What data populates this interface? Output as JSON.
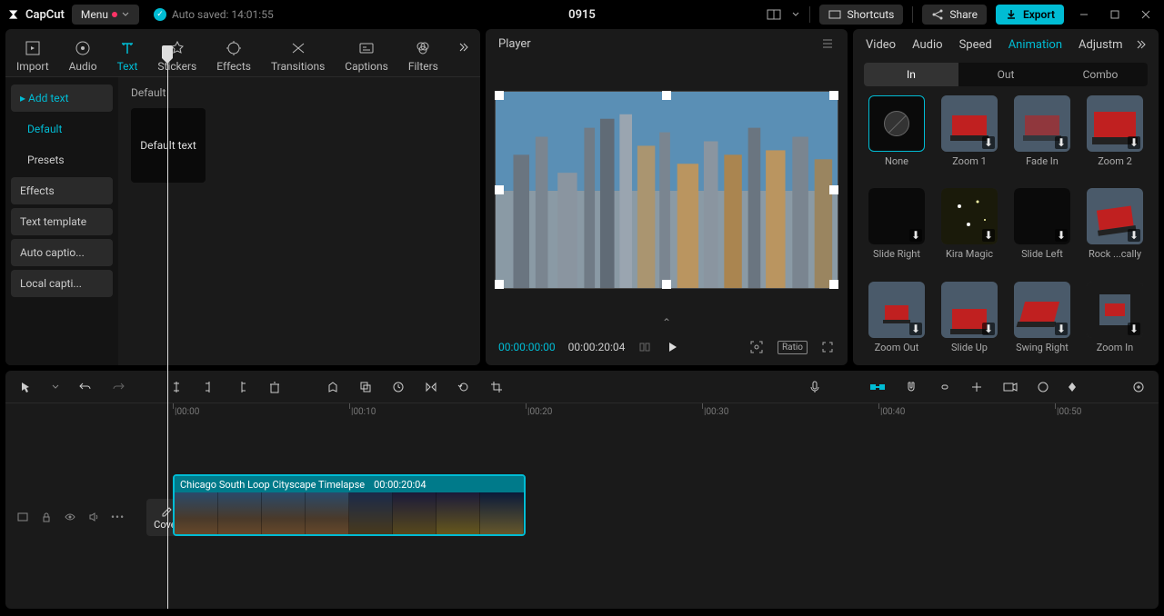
{
  "app": {
    "name": "CapCut",
    "menu": "Menu",
    "autosave": "Auto saved: 14:01:55",
    "title": "0915"
  },
  "topbar": {
    "shortcuts": "Shortcuts",
    "share": "Share",
    "export": "Export"
  },
  "tools": {
    "tabs": [
      "Import",
      "Audio",
      "Text",
      "Stickers",
      "Effects",
      "Transitions",
      "Captions",
      "Filters"
    ],
    "active": 2,
    "side": {
      "add_text": "Add text",
      "default": "Default",
      "presets": "Presets",
      "effects": "Effects",
      "text_template": "Text template",
      "auto_captions": "Auto captio...",
      "local_captions": "Local capti..."
    },
    "content_head": "Default",
    "default_text_card": "Default text"
  },
  "player": {
    "title": "Player",
    "current": "00:00:00:00",
    "duration": "00:00:20:04",
    "ratio": "Ratio"
  },
  "inspector": {
    "tabs": [
      "Video",
      "Audio",
      "Speed",
      "Animation",
      "Adjustm"
    ],
    "active": 3,
    "modes": [
      "In",
      "Out",
      "Combo"
    ],
    "mode_active": 0,
    "items": [
      "None",
      "Zoom 1",
      "Fade In",
      "Zoom 2",
      "Slide Right",
      "Kira Magic",
      "Slide Left",
      "Rock ...cally",
      "Zoom Out",
      "Slide Up",
      "Swing Right",
      "Zoom In"
    ]
  },
  "timeline": {
    "ticks": [
      "|00:00",
      "|00:10",
      "|00:20",
      "|00:30",
      "|00:40",
      "|00:50"
    ],
    "cover": "Cover",
    "clip": {
      "name": "Chicago South Loop Cityscape Timelapse",
      "dur": "00:00:20:04"
    }
  }
}
